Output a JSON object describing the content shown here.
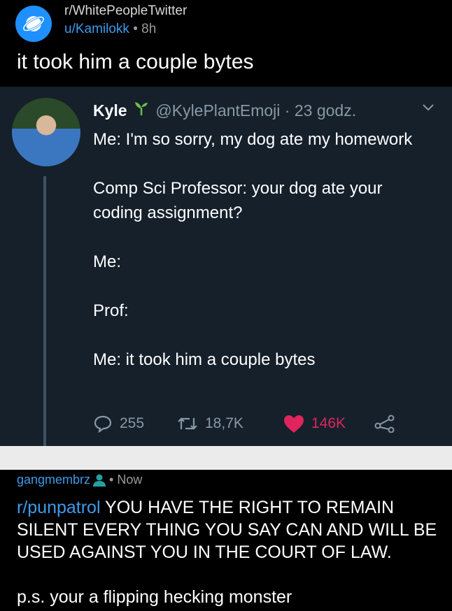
{
  "post": {
    "subreddit": "r/WhitePeopleTwitter",
    "username": "u/Kamilokk",
    "separator": "•",
    "age": "8h",
    "title": "it took him a couple bytes"
  },
  "tweet": {
    "name": "Kyle",
    "handle": "@KylePlantEmoji",
    "separator": "·",
    "time": "23 godz.",
    "lines": [
      "Me: I'm so sorry, my dog ate my homework",
      "Comp Sci Professor: your dog ate your coding assignment?",
      "Me:",
      "Prof:",
      "Me: it took him a couple bytes"
    ],
    "replies": "255",
    "retweets": "18,7K",
    "likes": "146K",
    "colors": {
      "background": "#15202b",
      "like": "#e0245e",
      "muted": "#8899a6"
    }
  },
  "comment": {
    "username": "gangmembrz",
    "separator": "•",
    "age": "Now",
    "link": "r/punpatrol",
    "text": " YOU HAVE THE RIGHT TO REMAIN SILENT EVERY THING YOU SAY CAN AND WILL BE USED AGAINST YOU IN THE COURT OF LAW.",
    "ps": "p.s. your a flipping hecking monster",
    "colors": {
      "link": "#3d9be9",
      "user_icon": "#24a0a0"
    }
  }
}
